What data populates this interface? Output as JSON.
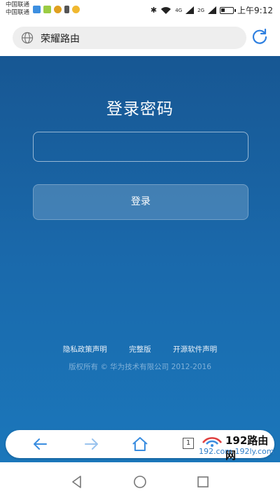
{
  "status_bar": {
    "carrier_1": "中国联通",
    "carrier_2": "中国联通",
    "network_1": "4G",
    "network_2": "2G",
    "time": "上午9:12"
  },
  "browser": {
    "url": "荣耀路由",
    "tab_count": "1"
  },
  "login": {
    "title": "登录密码",
    "password_value": "",
    "button_label": "登录"
  },
  "footer": {
    "links": [
      "隐私政策声明",
      "完整版",
      "开源软件声明"
    ],
    "copyright": "版权所有 © 华为技术有限公司 2012-2016"
  },
  "watermark": {
    "brand": "192路由网",
    "url": "192.com 192ly.com"
  },
  "colors": {
    "page_top": "#175793",
    "page_bottom": "#1b77bb",
    "toolbar_icon": "#3a8de0"
  }
}
